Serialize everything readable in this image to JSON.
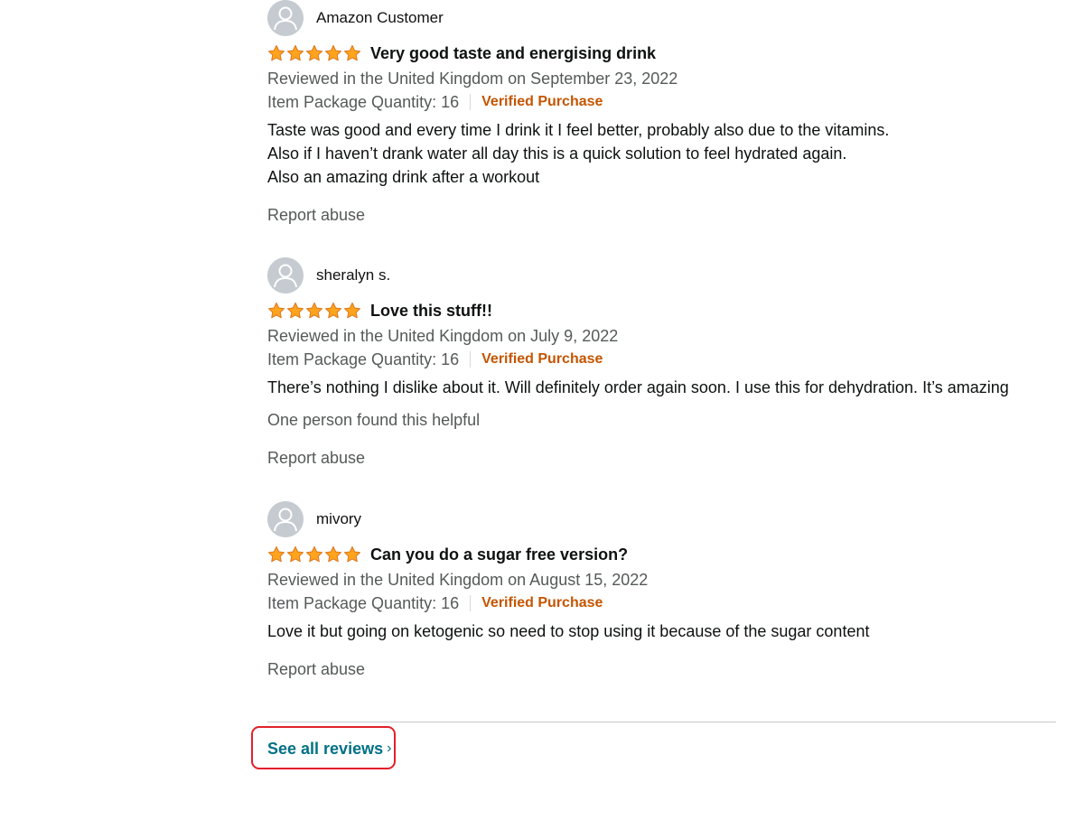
{
  "reviews": [
    {
      "name": "Amazon Customer",
      "rating": 5,
      "title": "Very good taste and energising drink",
      "date": "Reviewed in the United Kingdom on September 23, 2022",
      "quantity": "Item Package Quantity: 16",
      "verified": "Verified Purchase",
      "body": [
        "Taste was good and every time I drink it I feel better, probably also due to the vitamins.",
        "Also if I haven’t drank water all day this is a quick solution to feel hydrated again.",
        "Also an amazing drink after a workout"
      ],
      "helpful": "",
      "report": "Report abuse"
    },
    {
      "name": "sheralyn s.",
      "rating": 5,
      "title": "Love this stuff!!",
      "date": "Reviewed in the United Kingdom on July 9, 2022",
      "quantity": "Item Package Quantity: 16",
      "verified": "Verified Purchase",
      "body": [
        "There’s nothing I dislike about it. Will definitely order again soon. I use this for dehydration. It’s amazing"
      ],
      "helpful": "One person found this helpful",
      "report": "Report abuse"
    },
    {
      "name": "mivory",
      "rating": 5,
      "title": "Can you do a sugar free version?",
      "date": "Reviewed in the United Kingdom on August 15, 2022",
      "quantity": "Item Package Quantity: 16",
      "verified": "Verified Purchase",
      "body": [
        "Love it but going on ketogenic so need to stop using it because of the sugar content"
      ],
      "helpful": "",
      "report": "Report abuse"
    }
  ],
  "footer": {
    "see_all_label": "See all reviews",
    "chevron": "›"
  },
  "colors": {
    "link": "#007185",
    "verified": "#c45500",
    "star": "#ffa41c",
    "highlight": "#e3202a"
  },
  "icons": {
    "avatar": "user-avatar-icon",
    "star": "star-icon",
    "chevron": "chevron-right-icon"
  }
}
